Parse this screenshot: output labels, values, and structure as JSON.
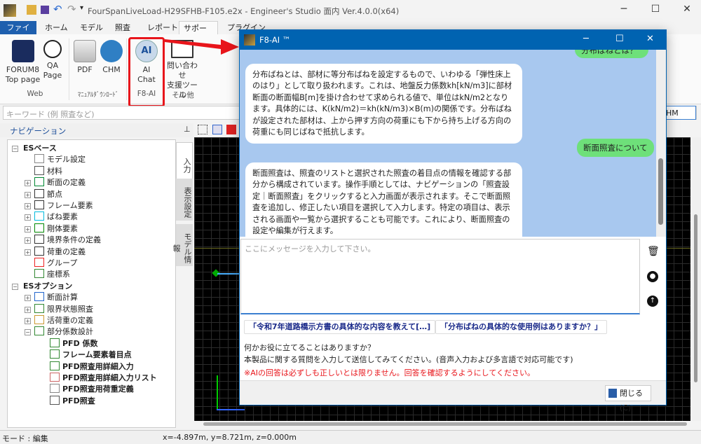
{
  "app": {
    "title": "FourSpanLiveLoad-H29SFHB-F105.e2x - Engineer's Studio 面内 Ver.4.0.0(x64)"
  },
  "ribbon": {
    "tabs": [
      "ファイル",
      "ホーム",
      "モデル",
      "照査",
      "レポート",
      "サポート",
      "プラグイン"
    ],
    "selected_tab": "サポート",
    "buttons": [
      {
        "line1": "FORUM8",
        "line2": "Top page"
      },
      {
        "line1": "QA",
        "line2": "Page"
      },
      {
        "line1": "PDF",
        "line2": ""
      },
      {
        "line1": "CHM",
        "line2": ""
      },
      {
        "line1": "AI",
        "line2": "Chat"
      },
      {
        "line1": "問い合わせ",
        "line2": "支援ツール"
      }
    ],
    "groups": [
      "Web",
      "ﾏﾆｭｱﾙﾀﾞｳﾝﾛｰﾄﾞ",
      "F8-AI",
      "その他"
    ],
    "highlight_color": "#e8151b"
  },
  "search": {
    "placeholder": "キーワード (例 照査など)",
    "right_button_partial": "HM"
  },
  "navigation": {
    "title": "ナビゲーション",
    "tree": [
      {
        "label": "ESベース",
        "level": 0,
        "exp": "−"
      },
      {
        "label": "モデル設定",
        "level": 1
      },
      {
        "label": "材料",
        "level": 1
      },
      {
        "label": "断面の定義",
        "level": 1,
        "exp": "+"
      },
      {
        "label": "節点",
        "level": 1,
        "exp": "+"
      },
      {
        "label": "フレーム要素",
        "level": 1,
        "exp": "+"
      },
      {
        "label": "ばね要素",
        "level": 1,
        "exp": "+"
      },
      {
        "label": "剛体要素",
        "level": 1,
        "exp": "+"
      },
      {
        "label": "境界条件の定義",
        "level": 1,
        "exp": "+"
      },
      {
        "label": "荷重の定義",
        "level": 1,
        "exp": "+"
      },
      {
        "label": "グループ",
        "level": 1
      },
      {
        "label": "座標系",
        "level": 1
      },
      {
        "label": "ESオプション",
        "level": 0,
        "exp": "−"
      },
      {
        "label": "断面計算",
        "level": 1,
        "exp": "+"
      },
      {
        "label": "限界状態照査",
        "level": 1,
        "exp": "+"
      },
      {
        "label": "活荷重の定義",
        "level": 1,
        "exp": "+"
      },
      {
        "label": "部分係数設計",
        "level": 1,
        "exp": "−"
      },
      {
        "label": "PFD 係数",
        "level": 2
      },
      {
        "label": "フレーム要素着目点",
        "level": 2
      },
      {
        "label": "PFD照査用詳細入力",
        "level": 2
      },
      {
        "label": "PFD照査用詳細入力リスト",
        "level": 2
      },
      {
        "label": "PFD照査用荷重定義",
        "level": 2
      },
      {
        "label": "PFD照査",
        "level": 2
      }
    ],
    "side_tabs": [
      "入力",
      "表示設定",
      "モデル情報"
    ],
    "selected_side_tab": "入力"
  },
  "status": {
    "mode": "モード : 編集",
    "coords": "x=-4.897m, y=8.721m, z=0.000m"
  },
  "dialog": {
    "title": "F8-AI ™",
    "messages": [
      {
        "role": "user",
        "text": "分布ばねとは？"
      },
      {
        "role": "assistant",
        "text": "分布ばねとは、部材に等分布ばねを設定するもので、いわゆる「弾性床上のはり」として取り扱われます。これは、地盤反力係数kh[kN/m3]に部材断面の断面幅B[m]を掛け合わせて求められる値で、単位はkN/m2となります。具体的には、K(kN/m2)＝kh(kN/m3)×B(m)の関係です。分布ばねが設定された部材は、上から押す方向の荷重にも下から持ち上げる方向の荷重にも同じばねで抵抗します。"
      },
      {
        "role": "user",
        "text": "断面照査について"
      },
      {
        "role": "assistant",
        "text": "断面照査は、照査のリストと選択された照査の着目点の情報を確認する部分から構成されています。操作手順としては、ナビゲーションの「照査設定｜断面照査」をクリックすると入力画面が表示されます。そこで断面照査を追加し、修正したい項目を選択して入力します。特定の項目は、表示される画面や一覧から選択することも可能です。これにより、断面照査の設定や編集が行えます。"
      }
    ],
    "input_placeholder": "ここにメッセージを入力して下さい。",
    "suggestions": [
      "「令和7年道路橋示方書の具体的な内容を教えて[…]",
      "「分布ばねの具体的な使用例はありますか？」"
    ],
    "info1": "何かお役に立てることはありますか？",
    "info2": "本製品に関する質問を入力して送信してみてください。(音声入力および多言語で対応可能です)",
    "warning": "※AIの回答は必ずしも正しいとは限りません。回答を確認するようにしてください。",
    "close_label": "閉じる(C)",
    "colors": {
      "titlebar": "#0063b1",
      "chat_bg": "#a8c8ef",
      "user_bubble": "#6ee07a",
      "warning": "#e8151b"
    }
  }
}
